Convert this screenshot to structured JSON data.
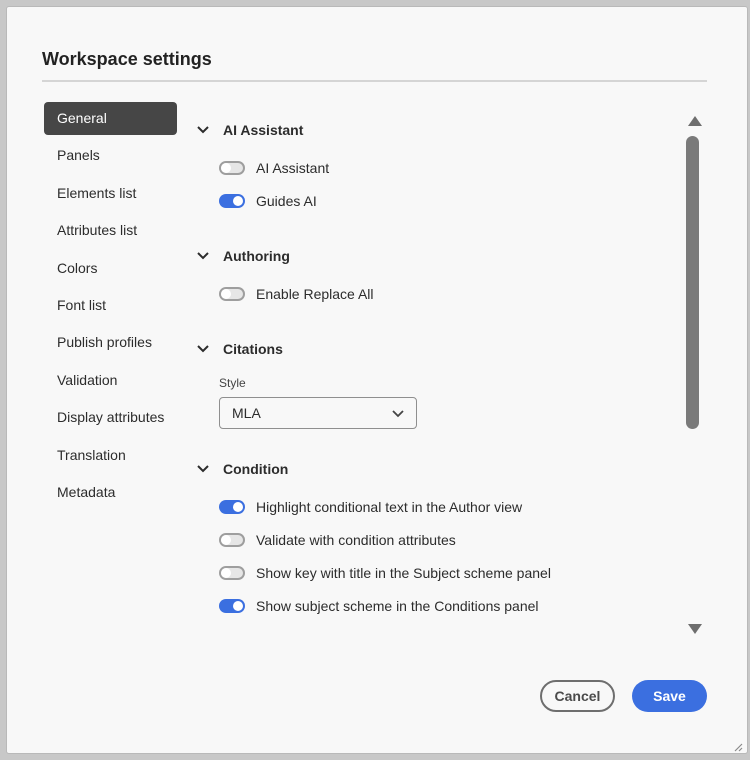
{
  "dialog": {
    "title": "Workspace settings"
  },
  "nav": {
    "items": [
      {
        "label": "General",
        "active": true
      },
      {
        "label": "Panels",
        "active": false
      },
      {
        "label": "Elements list",
        "active": false
      },
      {
        "label": "Attributes list",
        "active": false
      },
      {
        "label": "Colors",
        "active": false
      },
      {
        "label": "Font list",
        "active": false
      },
      {
        "label": "Publish profiles",
        "active": false
      },
      {
        "label": "Validation",
        "active": false
      },
      {
        "label": "Display attributes",
        "active": false
      },
      {
        "label": "Translation",
        "active": false
      },
      {
        "label": "Metadata",
        "active": false
      }
    ]
  },
  "sections": {
    "ai_assistant": {
      "heading": "AI Assistant",
      "toggles": [
        {
          "label": "AI Assistant",
          "on": false
        },
        {
          "label": "Guides AI",
          "on": true
        }
      ]
    },
    "authoring": {
      "heading": "Authoring",
      "toggles": [
        {
          "label": "Enable Replace All",
          "on": false
        }
      ]
    },
    "citations": {
      "heading": "Citations",
      "style_label": "Style",
      "style_value": "MLA"
    },
    "condition": {
      "heading": "Condition",
      "toggles": [
        {
          "label": "Highlight conditional text in the Author view",
          "on": true
        },
        {
          "label": "Validate with condition attributes",
          "on": false
        },
        {
          "label": "Show key with title in the Subject scheme panel",
          "on": false
        },
        {
          "label": "Show subject scheme in the Conditions panel",
          "on": true
        }
      ]
    }
  },
  "footer": {
    "cancel_label": "Cancel",
    "save_label": "Save"
  },
  "colors": {
    "accent": "#3b6fe0",
    "nav_active_bg": "#464646",
    "dialog_bg": "#f8f8f8"
  },
  "icons": {
    "section_toggle": "chevron-down-icon",
    "select_arrow": "chevron-down-icon",
    "scroll_up": "triangle-up-icon",
    "scroll_down": "triangle-down-icon",
    "resize": "resize-grip-icon"
  }
}
